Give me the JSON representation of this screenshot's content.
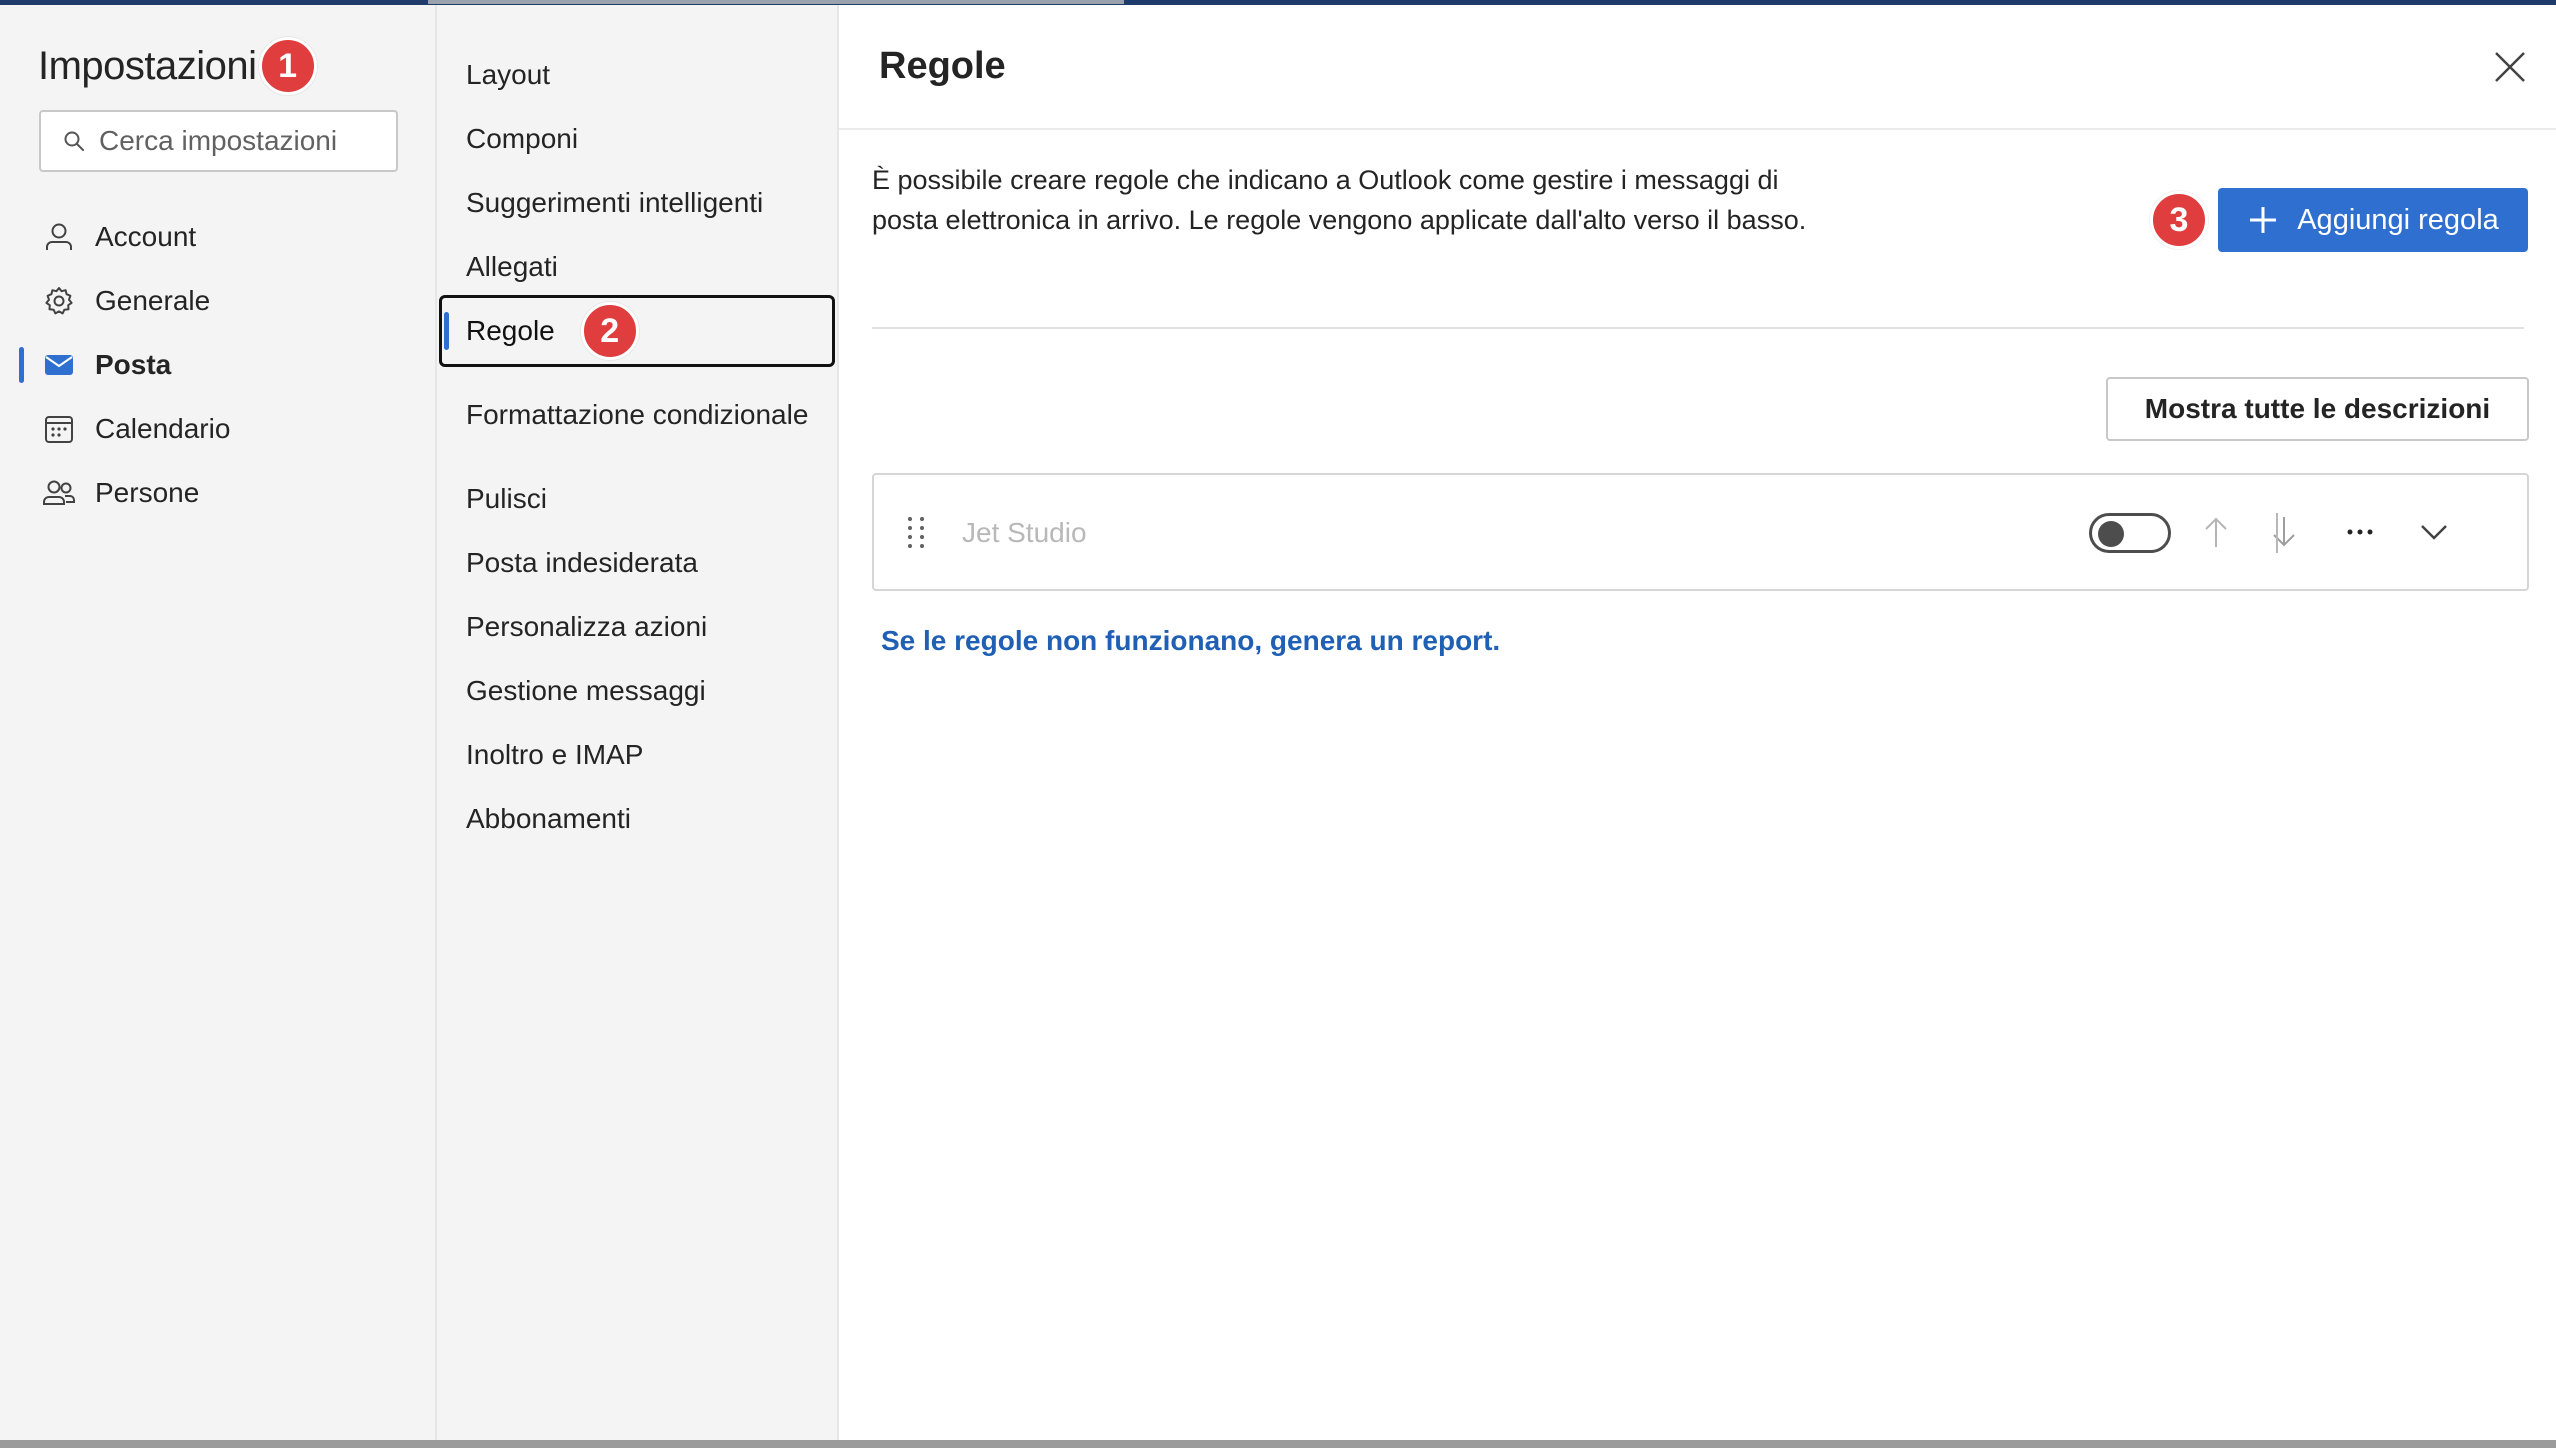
{
  "left": {
    "title": "Impostazioni",
    "badge": "1",
    "search_placeholder": "Cerca impostazioni",
    "nav": [
      {
        "label": "Account",
        "icon": "person-icon"
      },
      {
        "label": "Generale",
        "icon": "gear-icon"
      },
      {
        "label": "Posta",
        "icon": "mail-icon",
        "active": true
      },
      {
        "label": "Calendario",
        "icon": "calendar-icon"
      },
      {
        "label": "Persone",
        "icon": "people-icon"
      }
    ]
  },
  "middle": {
    "items": [
      {
        "label": "Layout"
      },
      {
        "label": "Componi"
      },
      {
        "label": "Suggerimenti intelligenti"
      },
      {
        "label": "Allegati"
      },
      {
        "label": "Regole",
        "selected": true,
        "badge": "2"
      },
      {
        "label": "Formattazione condizionale"
      },
      {
        "label": "Pulisci"
      },
      {
        "label": "Posta indesiderata"
      },
      {
        "label": "Personalizza azioni"
      },
      {
        "label": "Gestione messaggi"
      },
      {
        "label": "Inoltro e IMAP"
      },
      {
        "label": "Abbonamenti"
      }
    ]
  },
  "main": {
    "title": "Regole",
    "description": "È possibile creare regole che indicano a Outlook come gestire i messaggi di posta elettronica in arrivo. Le regole vengono applicate dall'alto verso il basso.",
    "add_badge": "3",
    "add_label": "Aggiungi regola",
    "show_all_label": "Mostra tutte le descrizioni",
    "rule": {
      "name": "Jet Studio",
      "enabled": false
    },
    "report_link": "Se le regole non funzionano, genera un report."
  },
  "colors": {
    "accent": "#2f6fcf",
    "badge": "#e03e3e",
    "link": "#1f5fb4"
  }
}
